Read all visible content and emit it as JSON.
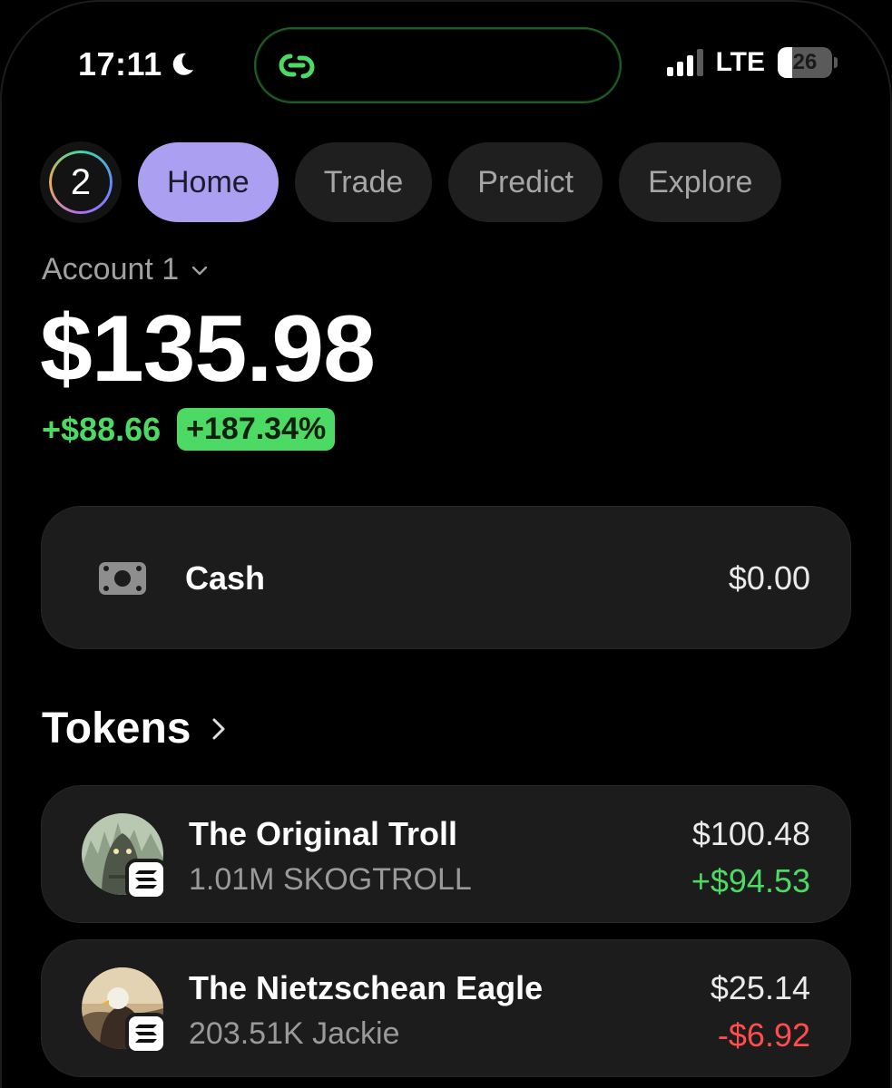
{
  "status_bar": {
    "time": "17:11",
    "network": "LTE",
    "battery_level": "26",
    "battery_fraction": 0.26,
    "signal_bars": 3
  },
  "colors": {
    "accent": "#ab9ff2",
    "positive": "#4cd964",
    "negative": "#ff4d4d",
    "island_border": "#1f5d23"
  },
  "nav": {
    "avatar_label": "2",
    "tabs": [
      {
        "label": "Home",
        "active": true
      },
      {
        "label": "Trade",
        "active": false
      },
      {
        "label": "Predict",
        "active": false
      },
      {
        "label": "Explore",
        "active": false
      }
    ]
  },
  "account": {
    "name": "Account 1",
    "balance": "$135.98",
    "change_abs": "+$88.66",
    "change_pct": "+187.34%"
  },
  "cash": {
    "icon": "cash-icon",
    "label": "Cash",
    "value": "$0.00"
  },
  "tokens": {
    "title": "Tokens",
    "items": [
      {
        "name": "The Original Troll",
        "amount": "1.01M SKOGTROLL",
        "value": "$100.48",
        "change": "+$94.53",
        "direction": "up"
      },
      {
        "name": "The Nietzschean Eagle",
        "amount": "203.51K Jackie",
        "value": "$25.14",
        "change": "-$6.92",
        "direction": "down"
      }
    ]
  }
}
